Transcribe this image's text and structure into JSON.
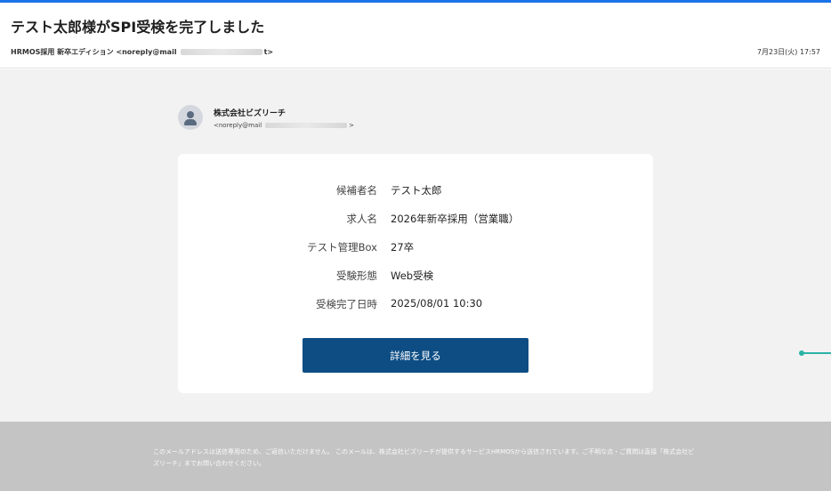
{
  "email": {
    "subject": "テスト太郎様がSPI受検を完了しました",
    "from_prefix": "HRMOS採用 新卒エディション <noreply@mail",
    "from_suffix": "t>",
    "date": "7月23日(火) 17:57"
  },
  "sender": {
    "company": "株式会社ビズリーチ",
    "email_prefix": "<noreply@mail",
    "email_suffix": ">",
    "avatar_icon": "person-icon"
  },
  "details": {
    "rows": [
      {
        "label": "候補者名",
        "value": "テスト太郎"
      },
      {
        "label": "求人名",
        "value": "2026年新卒採用（営業職）"
      },
      {
        "label": "テスト管理Box",
        "value": "27卒"
      },
      {
        "label": "受験形態",
        "value": "Web受検"
      },
      {
        "label": "受検完了日時",
        "value": "2025/08/01 10:30"
      }
    ]
  },
  "button": {
    "label": "詳細を見る",
    "color": "#0d4d84"
  },
  "footer": {
    "text": "このメールアドレスは送信専用のため、ご返信いただけません。 このメールは、株式会社ビズリーチが提供するサービスHRMOSから送信されています。ご不明な点・ご質問は直接「株式会社ビズリーチ」までお問い合わせください。"
  },
  "colors": {
    "accent": "#1a73e8",
    "connector": "#2ab3a6",
    "footer_bg": "#c4c4c4"
  }
}
